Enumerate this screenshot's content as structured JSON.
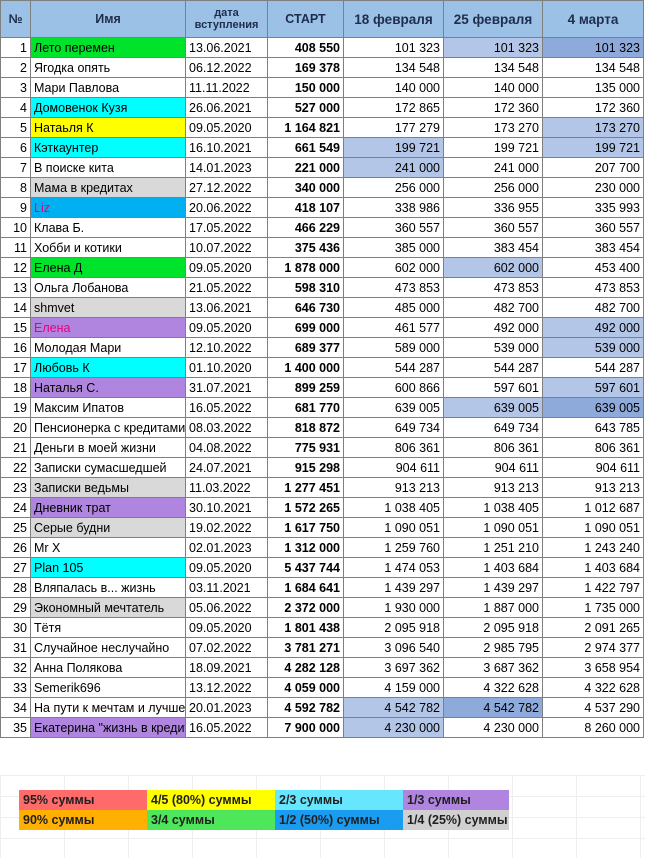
{
  "headers": {
    "num": "№",
    "name": "Имя",
    "date": "дата вступления",
    "start": "СТАРТ",
    "feb18": "18 февраля",
    "feb25": "25 февраля",
    "mar4": "4 марта"
  },
  "rows": [
    {
      "n": "1",
      "name": "Лето перемен",
      "date": "13.06.2021",
      "start": "408 550",
      "feb18": "101 323",
      "feb25": "101 323",
      "mar4": "101 323",
      "fill": "#00e32b",
      "hl": [
        0,
        1,
        2
      ]
    },
    {
      "n": "2",
      "name": "Ягодка опять",
      "date": "06.12.2022",
      "start": "169 378",
      "feb18": "134 548",
      "feb25": "134 548",
      "mar4": "134 548",
      "fill": "",
      "hl": [
        0,
        0,
        0
      ]
    },
    {
      "n": "3",
      "name": "Мари Павлова",
      "date": "11.11.2022",
      "start": "150 000",
      "feb18": "140 000",
      "feb25": "140 000",
      "mar4": "135 000",
      "fill": "",
      "hl": [
        0,
        0,
        0
      ]
    },
    {
      "n": "4",
      "name": "Домовенок Кузя",
      "date": "26.06.2021",
      "start": "527 000",
      "feb18": "172 865",
      "feb25": "172 360",
      "mar4": "172 360",
      "fill": "#00ffff",
      "hl": [
        0,
        0,
        0
      ]
    },
    {
      "n": "5",
      "name": "Натаьля К",
      "date": "09.05.2020",
      "start": "1 164 821",
      "feb18": "177 279",
      "feb25": "173 270",
      "mar4": "173 270",
      "fill": "#ffff00",
      "hl": [
        0,
        0,
        1
      ]
    },
    {
      "n": "6",
      "name": "Кэткаунтер",
      "date": "16.10.2021",
      "start": "661 549",
      "feb18": "199 721",
      "feb25": "199 721",
      "mar4": "199 721",
      "fill": "#00ffff",
      "hl": [
        1,
        0,
        1
      ]
    },
    {
      "n": "7",
      "name": "В поиске кита",
      "date": "14.01.2023",
      "start": "221 000",
      "feb18": "241 000",
      "feb25": "241 000",
      "mar4": "207 700",
      "fill": "",
      "hl": [
        1,
        0,
        0
      ]
    },
    {
      "n": "8",
      "name": "Мама в кредитах",
      "date": "27.12.2022",
      "start": "340 000",
      "feb18": "256 000",
      "feb25": "256 000",
      "mar4": "230 000",
      "fill": "#d9d9d9",
      "hl": [
        0,
        0,
        0
      ]
    },
    {
      "n": "9",
      "name": "Liz",
      "date": "20.06.2022",
      "start": "418 107",
      "feb18": "338 986",
      "feb25": "336 955",
      "mar4": "335 993",
      "fill": "#00b0f0",
      "color": "#e6007e",
      "hl": [
        0,
        0,
        0
      ]
    },
    {
      "n": "10",
      "name": "Клава Б.",
      "date": "17.05.2022",
      "start": "466 229",
      "feb18": "360 557",
      "feb25": "360 557",
      "mar4": "360 557",
      "fill": "",
      "hl": [
        0,
        0,
        0
      ]
    },
    {
      "n": "11",
      "name": "Хобби и котики",
      "date": "10.07.2022",
      "start": "375 436",
      "feb18": "385 000",
      "feb25": "383 454",
      "mar4": "383 454",
      "fill": "",
      "hl": [
        0,
        0,
        0
      ]
    },
    {
      "n": "12",
      "name": "Елена Д",
      "date": "09.05.2020",
      "start": "1 878 000",
      "feb18": "602 000",
      "feb25": "602 000",
      "mar4": "453 400",
      "fill": "#00e32b",
      "hl": [
        0,
        1,
        0
      ]
    },
    {
      "n": "13",
      "name": "Ольга Лобанова",
      "date": "21.05.2022",
      "start": "598 310",
      "feb18": "473 853",
      "feb25": "473 853",
      "mar4": "473 853",
      "fill": "",
      "hl": [
        0,
        0,
        0
      ]
    },
    {
      "n": "14",
      "name": "shmvet",
      "date": "13.06.2021",
      "start": "646 730",
      "feb18": "485 000",
      "feb25": "482 700",
      "mar4": "482 700",
      "fill": "#d9d9d9",
      "hl": [
        0,
        0,
        0
      ]
    },
    {
      "n": "15",
      "name": "Елена",
      "date": "09.05.2020",
      "start": "699 000",
      "feb18": "461 577",
      "feb25": "492 000",
      "mar4": "492 000",
      "fill": "#b085e0",
      "color": "#e6007e",
      "hl": [
        0,
        0,
        1
      ]
    },
    {
      "n": "16",
      "name": "Молодая Мари",
      "date": "12.10.2022",
      "start": "689 377",
      "feb18": "589 000",
      "feb25": "539 000",
      "mar4": "539 000",
      "fill": "",
      "hl": [
        0,
        0,
        1
      ]
    },
    {
      "n": "17",
      "name": "Любовь К",
      "date": "01.10.2020",
      "start": "1 400 000",
      "feb18": "544 287",
      "feb25": "544 287",
      "mar4": "544 287",
      "fill": "#00ffff",
      "hl": [
        0,
        0,
        0
      ]
    },
    {
      "n": "18",
      "name": "Наталья С.",
      "date": "31.07.2021",
      "start": "899 259",
      "feb18": "600 866",
      "feb25": "597 601",
      "mar4": "597 601",
      "fill": "#b085e0",
      "hl": [
        0,
        0,
        1
      ]
    },
    {
      "n": "19",
      "name": "Максим Ипатов",
      "date": "16.05.2022",
      "start": "681 770",
      "feb18": "639 005",
      "feb25": "639 005",
      "mar4": "639 005",
      "fill": "",
      "hl": [
        0,
        1,
        2
      ]
    },
    {
      "n": "20",
      "name": "Пенсионерка с кредитами",
      "date": "08.03.2022",
      "start": "818 872",
      "feb18": "649 734",
      "feb25": "649 734",
      "mar4": "643 785",
      "fill": "",
      "hl": [
        0,
        0,
        0
      ]
    },
    {
      "n": "21",
      "name": "Деньги в моей жизни",
      "date": "04.08.2022",
      "start": "775 931",
      "feb18": "806 361",
      "feb25": "806 361",
      "mar4": "806 361",
      "fill": "",
      "hl": [
        0,
        0,
        0
      ]
    },
    {
      "n": "22",
      "name": "Записки сумасшедшей",
      "date": "24.07.2021",
      "start": "915 298",
      "feb18": "904 611",
      "feb25": "904 611",
      "mar4": "904 611",
      "fill": "",
      "hl": [
        0,
        0,
        0
      ]
    },
    {
      "n": "23",
      "name": "Записки ведьмы",
      "date": "11.03.2022",
      "start": "1 277 451",
      "feb18": "913 213",
      "feb25": "913 213",
      "mar4": "913 213",
      "fill": "#d9d9d9",
      "hl": [
        0,
        0,
        0
      ]
    },
    {
      "n": "24",
      "name": "Дневник трат",
      "date": "30.10.2021",
      "start": "1 572 265",
      "feb18": "1 038 405",
      "feb25": "1 038 405",
      "mar4": "1 012 687",
      "fill": "#b085e0",
      "hl": [
        0,
        0,
        0
      ]
    },
    {
      "n": "25",
      "name": "Серые будни",
      "date": "19.02.2022",
      "start": "1 617 750",
      "feb18": "1 090 051",
      "feb25": "1 090 051",
      "mar4": "1 090 051",
      "fill": "#d9d9d9",
      "hl": [
        0,
        0,
        0
      ]
    },
    {
      "n": "26",
      "name": "Mr X",
      "date": "02.01.2023",
      "start": "1 312 000",
      "feb18": "1 259 760",
      "feb25": "1 251 210",
      "mar4": "1 243 240",
      "fill": "",
      "hl": [
        0,
        0,
        0
      ]
    },
    {
      "n": "27",
      "name": "Plan 105",
      "date": "09.05.2020",
      "start": "5 437 744",
      "feb18": "1 474 053",
      "feb25": "1 403 684",
      "mar4": "1 403 684",
      "fill": "#00ffff",
      "hl": [
        0,
        0,
        0
      ]
    },
    {
      "n": "28",
      "name": "Вляпалась в... жизнь",
      "date": "03.11.2021",
      "start": "1 684 641",
      "feb18": "1 439 297",
      "feb25": "1 439 297",
      "mar4": "1 422 797",
      "fill": "",
      "hl": [
        0,
        0,
        0
      ]
    },
    {
      "n": "29",
      "name": "Экономный мечтатель",
      "date": "05.06.2022",
      "start": "2 372 000",
      "feb18": "1 930 000",
      "feb25": "1 887 000",
      "mar4": "1 735 000",
      "fill": "#d9d9d9",
      "hl": [
        0,
        0,
        0
      ]
    },
    {
      "n": "30",
      "name": "Тётя",
      "date": "09.05.2020",
      "start": "1 801 438",
      "feb18": "2 095 918",
      "feb25": "2 095 918",
      "mar4": "2 091 265",
      "fill": "",
      "hl": [
        0,
        0,
        0
      ]
    },
    {
      "n": "31",
      "name": "Случайное неслучайно",
      "date": "07.02.2022",
      "start": "3 781 271",
      "feb18": "3 096 540",
      "feb25": "2 985 795",
      "mar4": "2 974 377",
      "fill": "",
      "hl": [
        0,
        0,
        0
      ]
    },
    {
      "n": "32",
      "name": "Анна Полякова",
      "date": "18.09.2021",
      "start": "4 282 128",
      "feb18": "3 697 362",
      "feb25": "3 687 362",
      "mar4": "3 658 954",
      "fill": "",
      "hl": [
        0,
        0,
        0
      ]
    },
    {
      "n": "33",
      "name": "Semerik696",
      "date": "13.12.2022",
      "start": "4 059 000",
      "feb18": "4 159 000",
      "feb25": "4 322 628",
      "mar4": "4 322 628",
      "fill": "",
      "hl": [
        0,
        0,
        0
      ]
    },
    {
      "n": "34",
      "name": "На пути к мечтам и лучшей жизни",
      "date": "20.01.2023",
      "start": "4 592 782",
      "feb18": "4 542 782",
      "feb25": "4 542 782",
      "mar4": "4 537 290",
      "fill": "",
      "hl": [
        1,
        2,
        0
      ]
    },
    {
      "n": "35",
      "name": "Екатерина \"жизнь в кредит\"",
      "date": "16.05.2022",
      "start": "7 900 000",
      "feb18": "4 230 000",
      "feb25": "4 230 000",
      "mar4": "8 260 000",
      "fill": "#b085e0",
      "hl": [
        1,
        0,
        0
      ]
    }
  ],
  "legend": [
    {
      "label": "95% суммы",
      "color": "#ff6b6b"
    },
    {
      "label": "4/5 (80%) суммы",
      "color": "#ffff00"
    },
    {
      "label": "2/3 суммы",
      "color": "#66e6ff"
    },
    {
      "label": "1/3 суммы",
      "color": "#b085e0"
    },
    {
      "label": "90% суммы",
      "color": "#ffb000"
    },
    {
      "label": "3/4 суммы",
      "color": "#4ee65a"
    },
    {
      "label": "1/2 (50%) суммы",
      "color": "#1a9cf0"
    },
    {
      "label": "1/4 (25%) суммы",
      "color": "#d0d0d0"
    }
  ]
}
